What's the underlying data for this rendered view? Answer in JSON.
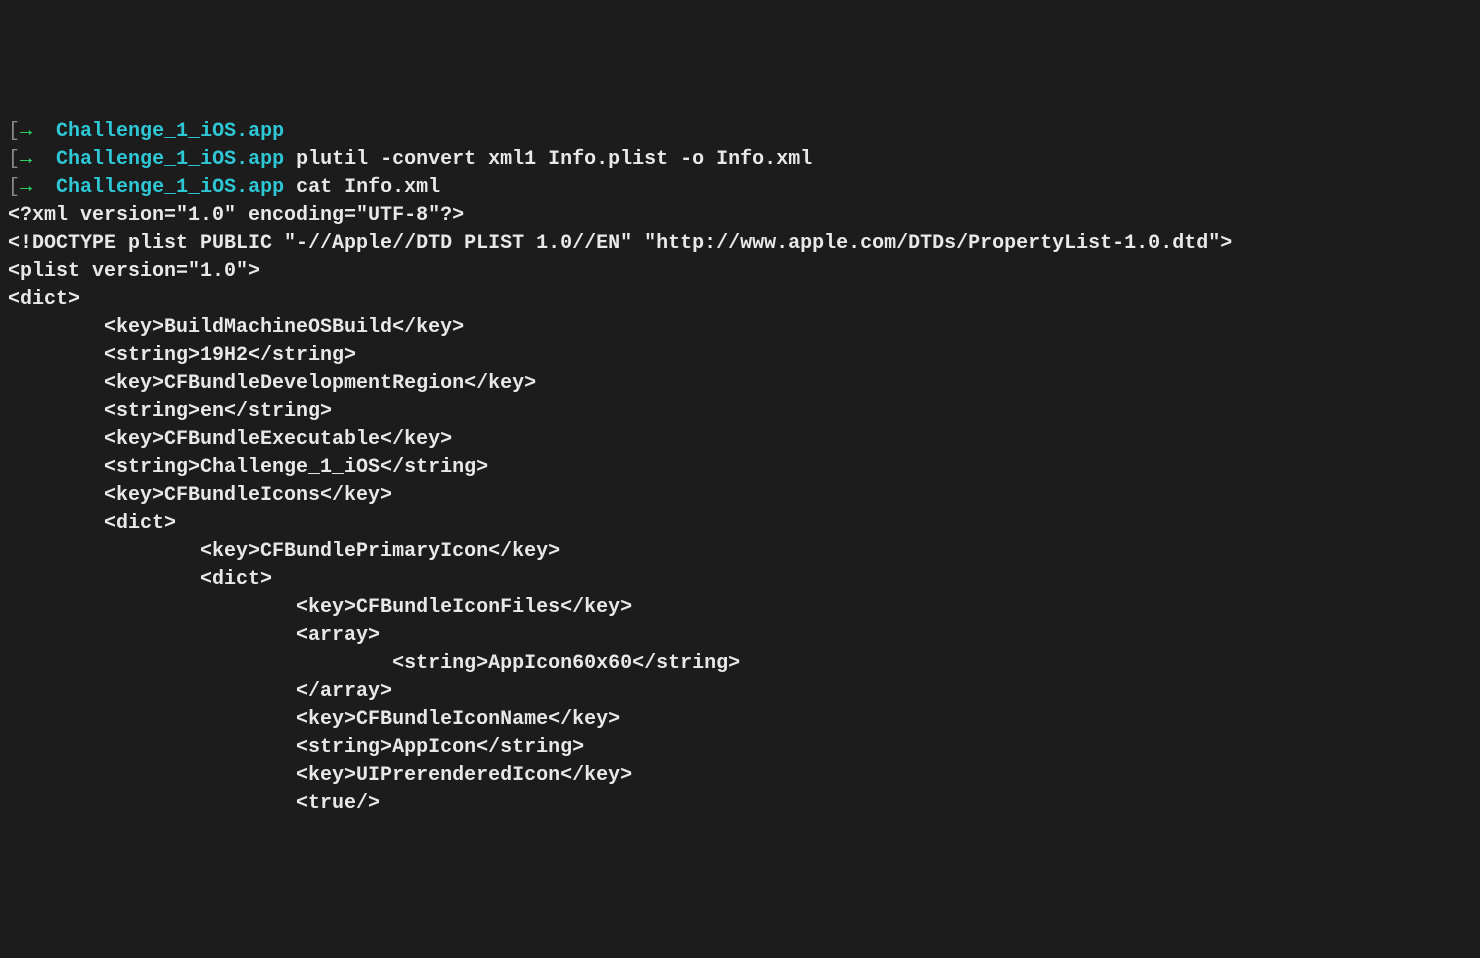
{
  "prompts": [
    {
      "dir": "Challenge_1_iOS.app",
      "cmd": ""
    },
    {
      "dir": "Challenge_1_iOS.app",
      "cmd": "plutil -convert xml1 Info.plist -o Info.xml"
    },
    {
      "dir": "Challenge_1_iOS.app",
      "cmd": "cat Info.xml"
    }
  ],
  "output": [
    "<?xml version=\"1.0\" encoding=\"UTF-8\"?>",
    "<!DOCTYPE plist PUBLIC \"-//Apple//DTD PLIST 1.0//EN\" \"http://www.apple.com/DTDs/PropertyList-1.0.dtd\">",
    "<plist version=\"1.0\">",
    "<dict>",
    "        <key>BuildMachineOSBuild</key>",
    "        <string>19H2</string>",
    "        <key>CFBundleDevelopmentRegion</key>",
    "        <string>en</string>",
    "        <key>CFBundleExecutable</key>",
    "        <string>Challenge_1_iOS</string>",
    "        <key>CFBundleIcons</key>",
    "        <dict>",
    "                <key>CFBundlePrimaryIcon</key>",
    "                <dict>",
    "                        <key>CFBundleIconFiles</key>",
    "                        <array>",
    "                                <string>AppIcon60x60</string>",
    "                        </array>",
    "                        <key>CFBundleIconName</key>",
    "                        <string>AppIcon</string>",
    "                        <key>UIPrerenderedIcon</key>",
    "                        <true/>"
  ],
  "glyphs": {
    "bracket": "[",
    "arrow": "→"
  }
}
